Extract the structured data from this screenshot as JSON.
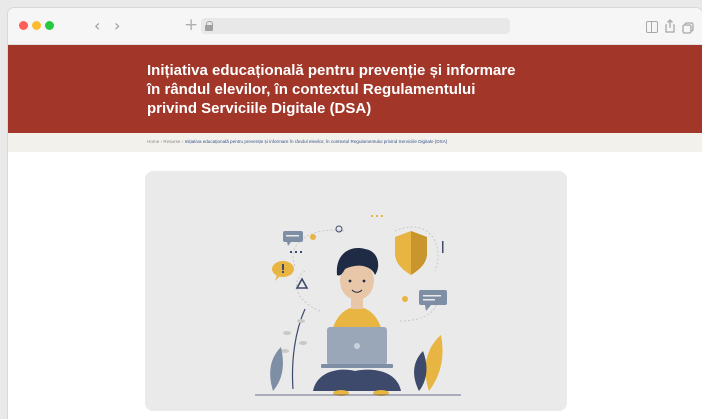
{
  "browser": {
    "traffic_lights": {
      "close": "#ff5f57",
      "minimize": "#febc2e",
      "zoom": "#28c840"
    },
    "back_glyph": "‹",
    "forward_glyph": "›",
    "new_tab_glyph": "+",
    "address_icon": "lock-icon",
    "toolbar_icons": [
      "sidebar-icon",
      "share-icon",
      "tabs-icon"
    ]
  },
  "hero": {
    "background": "#a23629",
    "title": "Inițiativa educațională pentru prevenție și informare în rândul elevilor, în contextul Regulamentului privind Serviciile Digitale (DSA)"
  },
  "breadcrumb": {
    "items": [
      "Home",
      "Resurse",
      "Inițiativa educațională pentru prevenție și informare în rândul elevilor, în contextul Regulamentului privind Serviciile Digitale (DSA)"
    ],
    "separator": "›"
  },
  "illustration": {
    "subject": "person-with-laptop-illustration",
    "accent_colors": [
      "#e8b543",
      "#3d4a6b",
      "#7d8ea5"
    ]
  }
}
